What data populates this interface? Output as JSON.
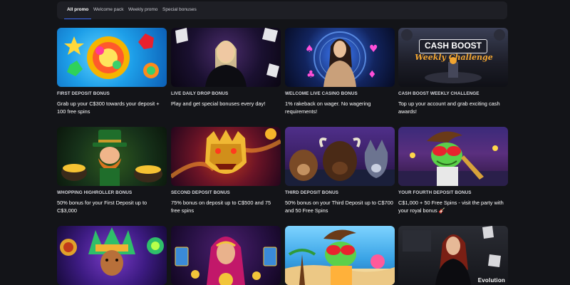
{
  "tabs": [
    {
      "label": "All promo",
      "active": true
    },
    {
      "label": "Welcome pack",
      "active": false
    },
    {
      "label": "Weekly promo",
      "active": false
    },
    {
      "label": "Special bonuses",
      "active": false
    }
  ],
  "accent_color": "#3f6ef5",
  "promos": [
    {
      "title": "FIRST DEPOSIT BONUS",
      "description": "Grab up your C$300 towards your deposit + 100 free spins",
      "image_icon": "gem-slot-art"
    },
    {
      "title": "LIVE DAILY DROP BONUS",
      "description": "Play and get special bonuses every day!",
      "image_icon": "live-dealer-art"
    },
    {
      "title": "WELCOME LIVE CASINO BONUS",
      "description": "1% rakeback on wager. No wagering requirements!",
      "image_icon": "live-dealer-art"
    },
    {
      "title": "CASH BOOST WEEKLY CHALLENGE",
      "description": "Top up your account and grab exciting cash awards!",
      "image_icon": "cash-boost-art",
      "image_text": {
        "headline": "CASH BOOST",
        "subline": "Weekly Challenge"
      }
    },
    {
      "title": "WHOPPING HIGHROLLER BONUS",
      "description": "50% bonus for your First Deposit up to C$3,000",
      "image_icon": "leprechaun-art"
    },
    {
      "title": "SECOND DEPOSIT BONUS",
      "description": "75% bonus on deposit up to C$500 and 75 free spins",
      "image_icon": "golden-dragon-art"
    },
    {
      "title": "THIRD DEPOSIT BONUS",
      "description": "50% bonus on your Third Deposit up to C$700 and 50 Free Spins",
      "image_icon": "wild-animals-art"
    },
    {
      "title": "YOUR FOURTH DEPOSIT BONUS",
      "description": "C$1,000 + 50 Free Spins - visit the party with your royal bonus 🎸",
      "image_icon": "frog-party-art"
    },
    {
      "title": "",
      "description": "",
      "image_icon": "aztec-warrior-art"
    },
    {
      "title": "",
      "description": "",
      "image_icon": "fortune-teller-art"
    },
    {
      "title": "",
      "description": "",
      "image_icon": "frog-party-art"
    },
    {
      "title": "",
      "description": "",
      "image_icon": "live-dealer-art",
      "image_text": {
        "brand": "Evolution"
      }
    }
  ]
}
